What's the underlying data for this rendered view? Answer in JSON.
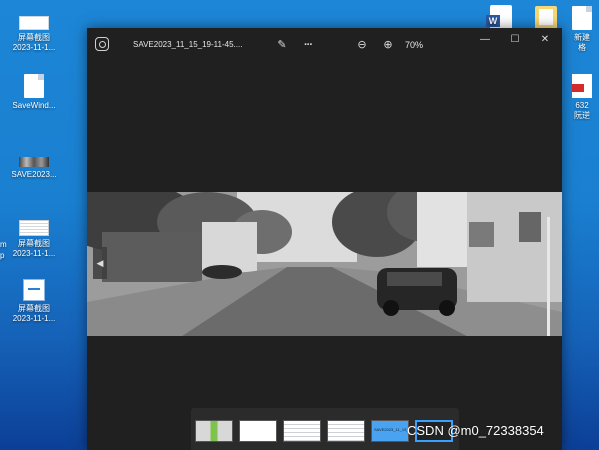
{
  "desktop": {
    "left_icons": [
      {
        "label1": "屏幕截图",
        "label2": "2023-11-1..."
      },
      {
        "label1": "SaveWind...",
        "label2": ""
      },
      {
        "label1": "SAVE2023...",
        "label2": ""
      },
      {
        "label1": "屏幕截图",
        "label2": "2023-11-1..."
      },
      {
        "label1": "屏幕截图",
        "label2": "2023-11-1..."
      }
    ],
    "side_text": [
      "m",
      "p"
    ],
    "right_icons": [
      {
        "label1": "",
        "label2": ""
      },
      {
        "label1": "新建",
        "label2": "格"
      },
      {
        "label1": "632",
        "label2": "阮逆"
      }
    ],
    "word_badge": "W"
  },
  "window": {
    "title": "SAVE2023_11_15_19-11-45....",
    "zoom": "70%",
    "icons": {
      "app": "photos-app-icon",
      "edit": "edit-image-icon",
      "more": "more-icon",
      "zoom_out": "zoom-out-icon",
      "zoom_in": "zoom-in-icon",
      "minimize": "minimize-icon",
      "maximize": "maximize-icon",
      "close": "close-icon"
    },
    "glyphs": {
      "edit": "✎",
      "more": "···",
      "zoom_out": "⊖",
      "zoom_in": "⊕",
      "minimize": "—",
      "maximize": "☐",
      "close": "✕",
      "prev": "◀"
    },
    "photo_alt": "grayscale street scene",
    "filmstrip_selected_text": "SAVE2023_11_15_19..._45.png"
  },
  "watermark": "CSDN @m0_72338354"
}
